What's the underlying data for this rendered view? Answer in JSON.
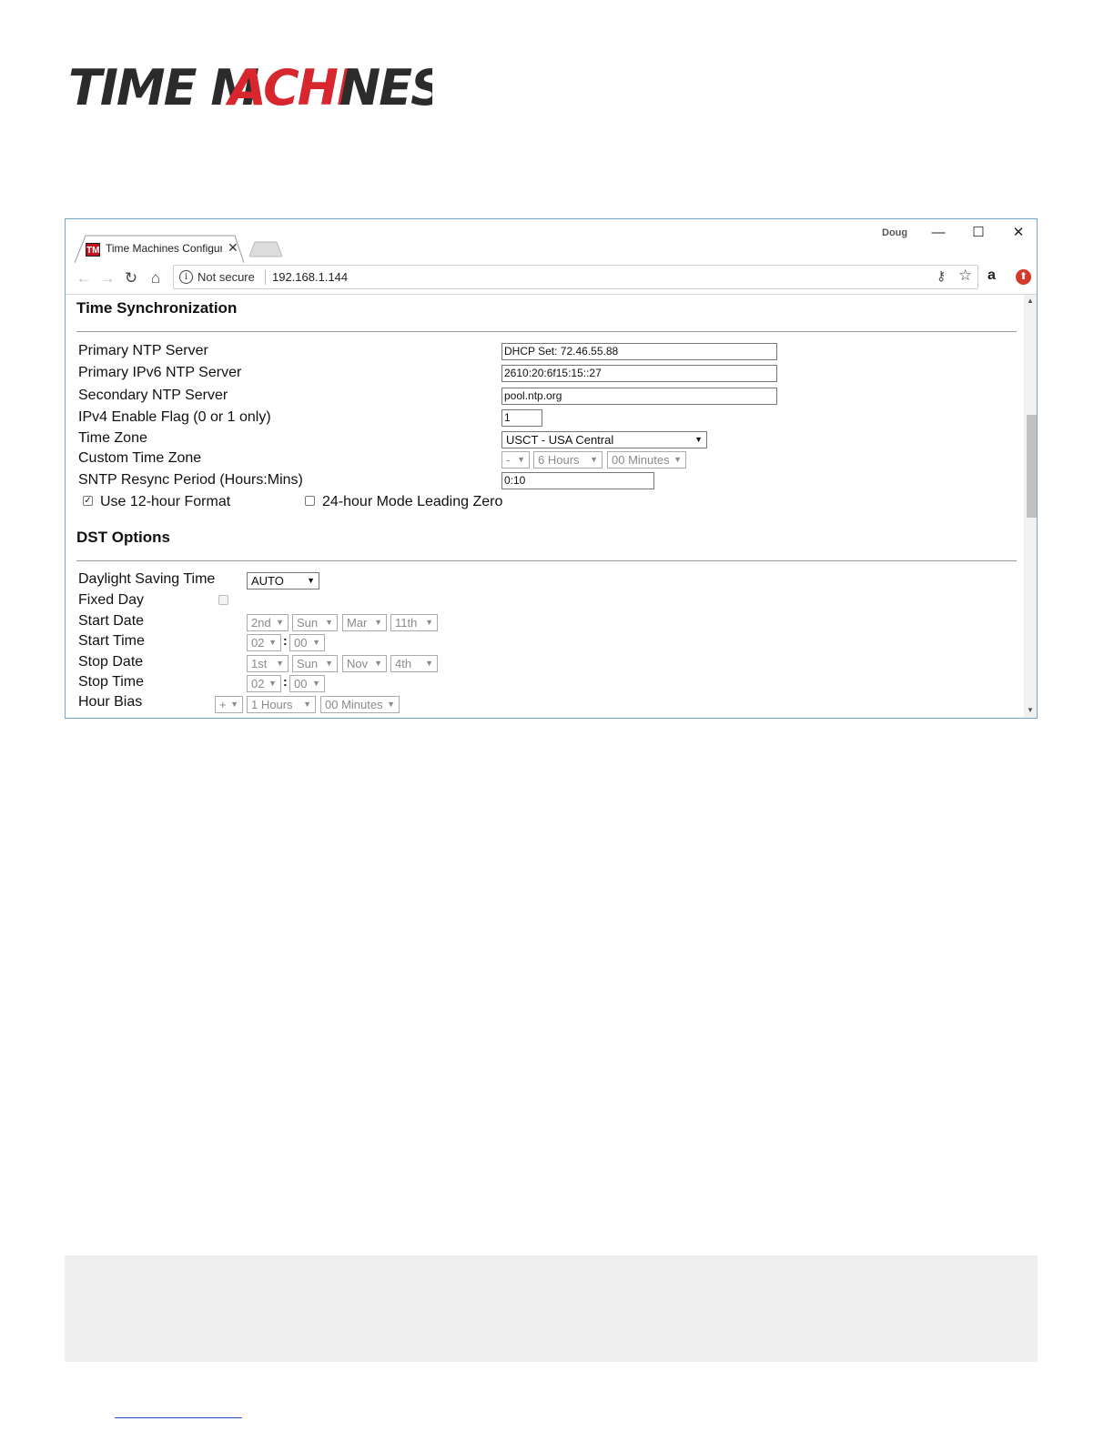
{
  "logo": {
    "text": "TIME MACHINES"
  },
  "browser": {
    "tab_title": "Time Machines Configura",
    "tab_close": "✕",
    "profile_name": "Doug",
    "minimize": "—",
    "maximize": "☐",
    "close": "✕",
    "security_label": "Not secure",
    "url": "192.168.1.144",
    "favicon_text": "TM",
    "amazon_icon": "a"
  },
  "time_sync": {
    "title": "Time Synchronization",
    "primary_ntp": {
      "label": "Primary NTP Server",
      "value": "DHCP Set: 72.46.55.88"
    },
    "primary_ipv6_ntp": {
      "label": "Primary IPv6 NTP Server",
      "value": "2610:20:6f15:15::27"
    },
    "secondary_ntp": {
      "label": "Secondary NTP Server",
      "value": "pool.ntp.org"
    },
    "ipv4_enable": {
      "label": "IPv4 Enable Flag (0 or 1 only)",
      "value": "1"
    },
    "time_zone": {
      "label": "Time Zone",
      "value": "USCT - USA Central"
    },
    "custom_time_zone": {
      "label": "Custom Time Zone",
      "sign": "-",
      "hours": "6 Hours",
      "minutes": "00 Minutes"
    },
    "resync": {
      "label": "SNTP Resync Period (Hours:Mins)",
      "value": "0:10"
    },
    "use_12_hour": {
      "label": "Use 12-hour Format",
      "checked": true
    },
    "leading_zero": {
      "label": "24-hour Mode Leading Zero",
      "checked": false
    }
  },
  "dst": {
    "title": "DST Options",
    "daylight_saving": {
      "label": "Daylight Saving Time",
      "value": "AUTO"
    },
    "fixed_day": {
      "label": "Fixed Day",
      "checked": false
    },
    "start_date": {
      "label": "Start Date",
      "week": "2nd",
      "day": "Sun",
      "month": "Mar",
      "date": "11th"
    },
    "start_time": {
      "label": "Start Time",
      "hour": "02",
      "minute": "00"
    },
    "stop_date": {
      "label": "Stop Date",
      "week": "1st",
      "day": "Sun",
      "month": "Nov",
      "date": "4th"
    },
    "stop_time": {
      "label": "Stop Time",
      "hour": "02",
      "minute": "00"
    },
    "hour_bias": {
      "label": "Hour Bias",
      "sign": "+",
      "hours": "1 Hours",
      "minutes": "00 Minutes"
    }
  },
  "icons": {
    "back": "back-arrow-icon",
    "forward": "forward-arrow-icon",
    "reload": "reload-icon",
    "home": "home-icon",
    "info": "info-icon",
    "key": "key-icon",
    "star": "star-icon",
    "amazon": "amazon-icon",
    "extension": "extension-icon"
  },
  "colors": {
    "window_border": "#6fa7d2",
    "logo_accent": "#d7262e",
    "favicon": "#c2121c"
  }
}
